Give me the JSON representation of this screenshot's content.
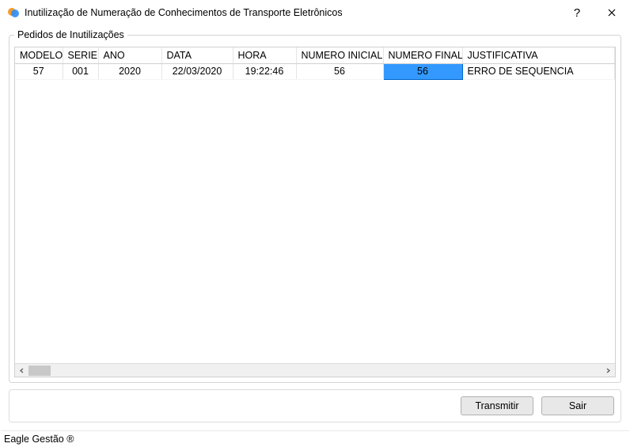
{
  "window": {
    "title": "Inutilização de Numeração de Conhecimentos de Transporte Eletrônicos"
  },
  "group": {
    "title": "Pedidos de Inutilizações"
  },
  "table": {
    "headers": {
      "modelo": "MODELO",
      "serie": "SERIE",
      "ano": "ANO",
      "data": "DATA",
      "hora": "HORA",
      "numero_inicial": "NUMERO INICIAL",
      "numero_final": "NUMERO FINAL",
      "justificativa": "JUSTIFICATIVA"
    },
    "rows": [
      {
        "modelo": "57",
        "serie": "001",
        "ano": "2020",
        "data": "22/03/2020",
        "hora": "19:22:46",
        "numero_inicial": "56",
        "numero_final": "56",
        "justificativa": "ERRO DE SEQUENCIA"
      }
    ],
    "selected_cell": {
      "row": 0,
      "col": "numero_final"
    }
  },
  "buttons": {
    "transmitir": "Transmitir",
    "sair": "Sair"
  },
  "statusbar": {
    "text": "Eagle Gestão ®"
  }
}
